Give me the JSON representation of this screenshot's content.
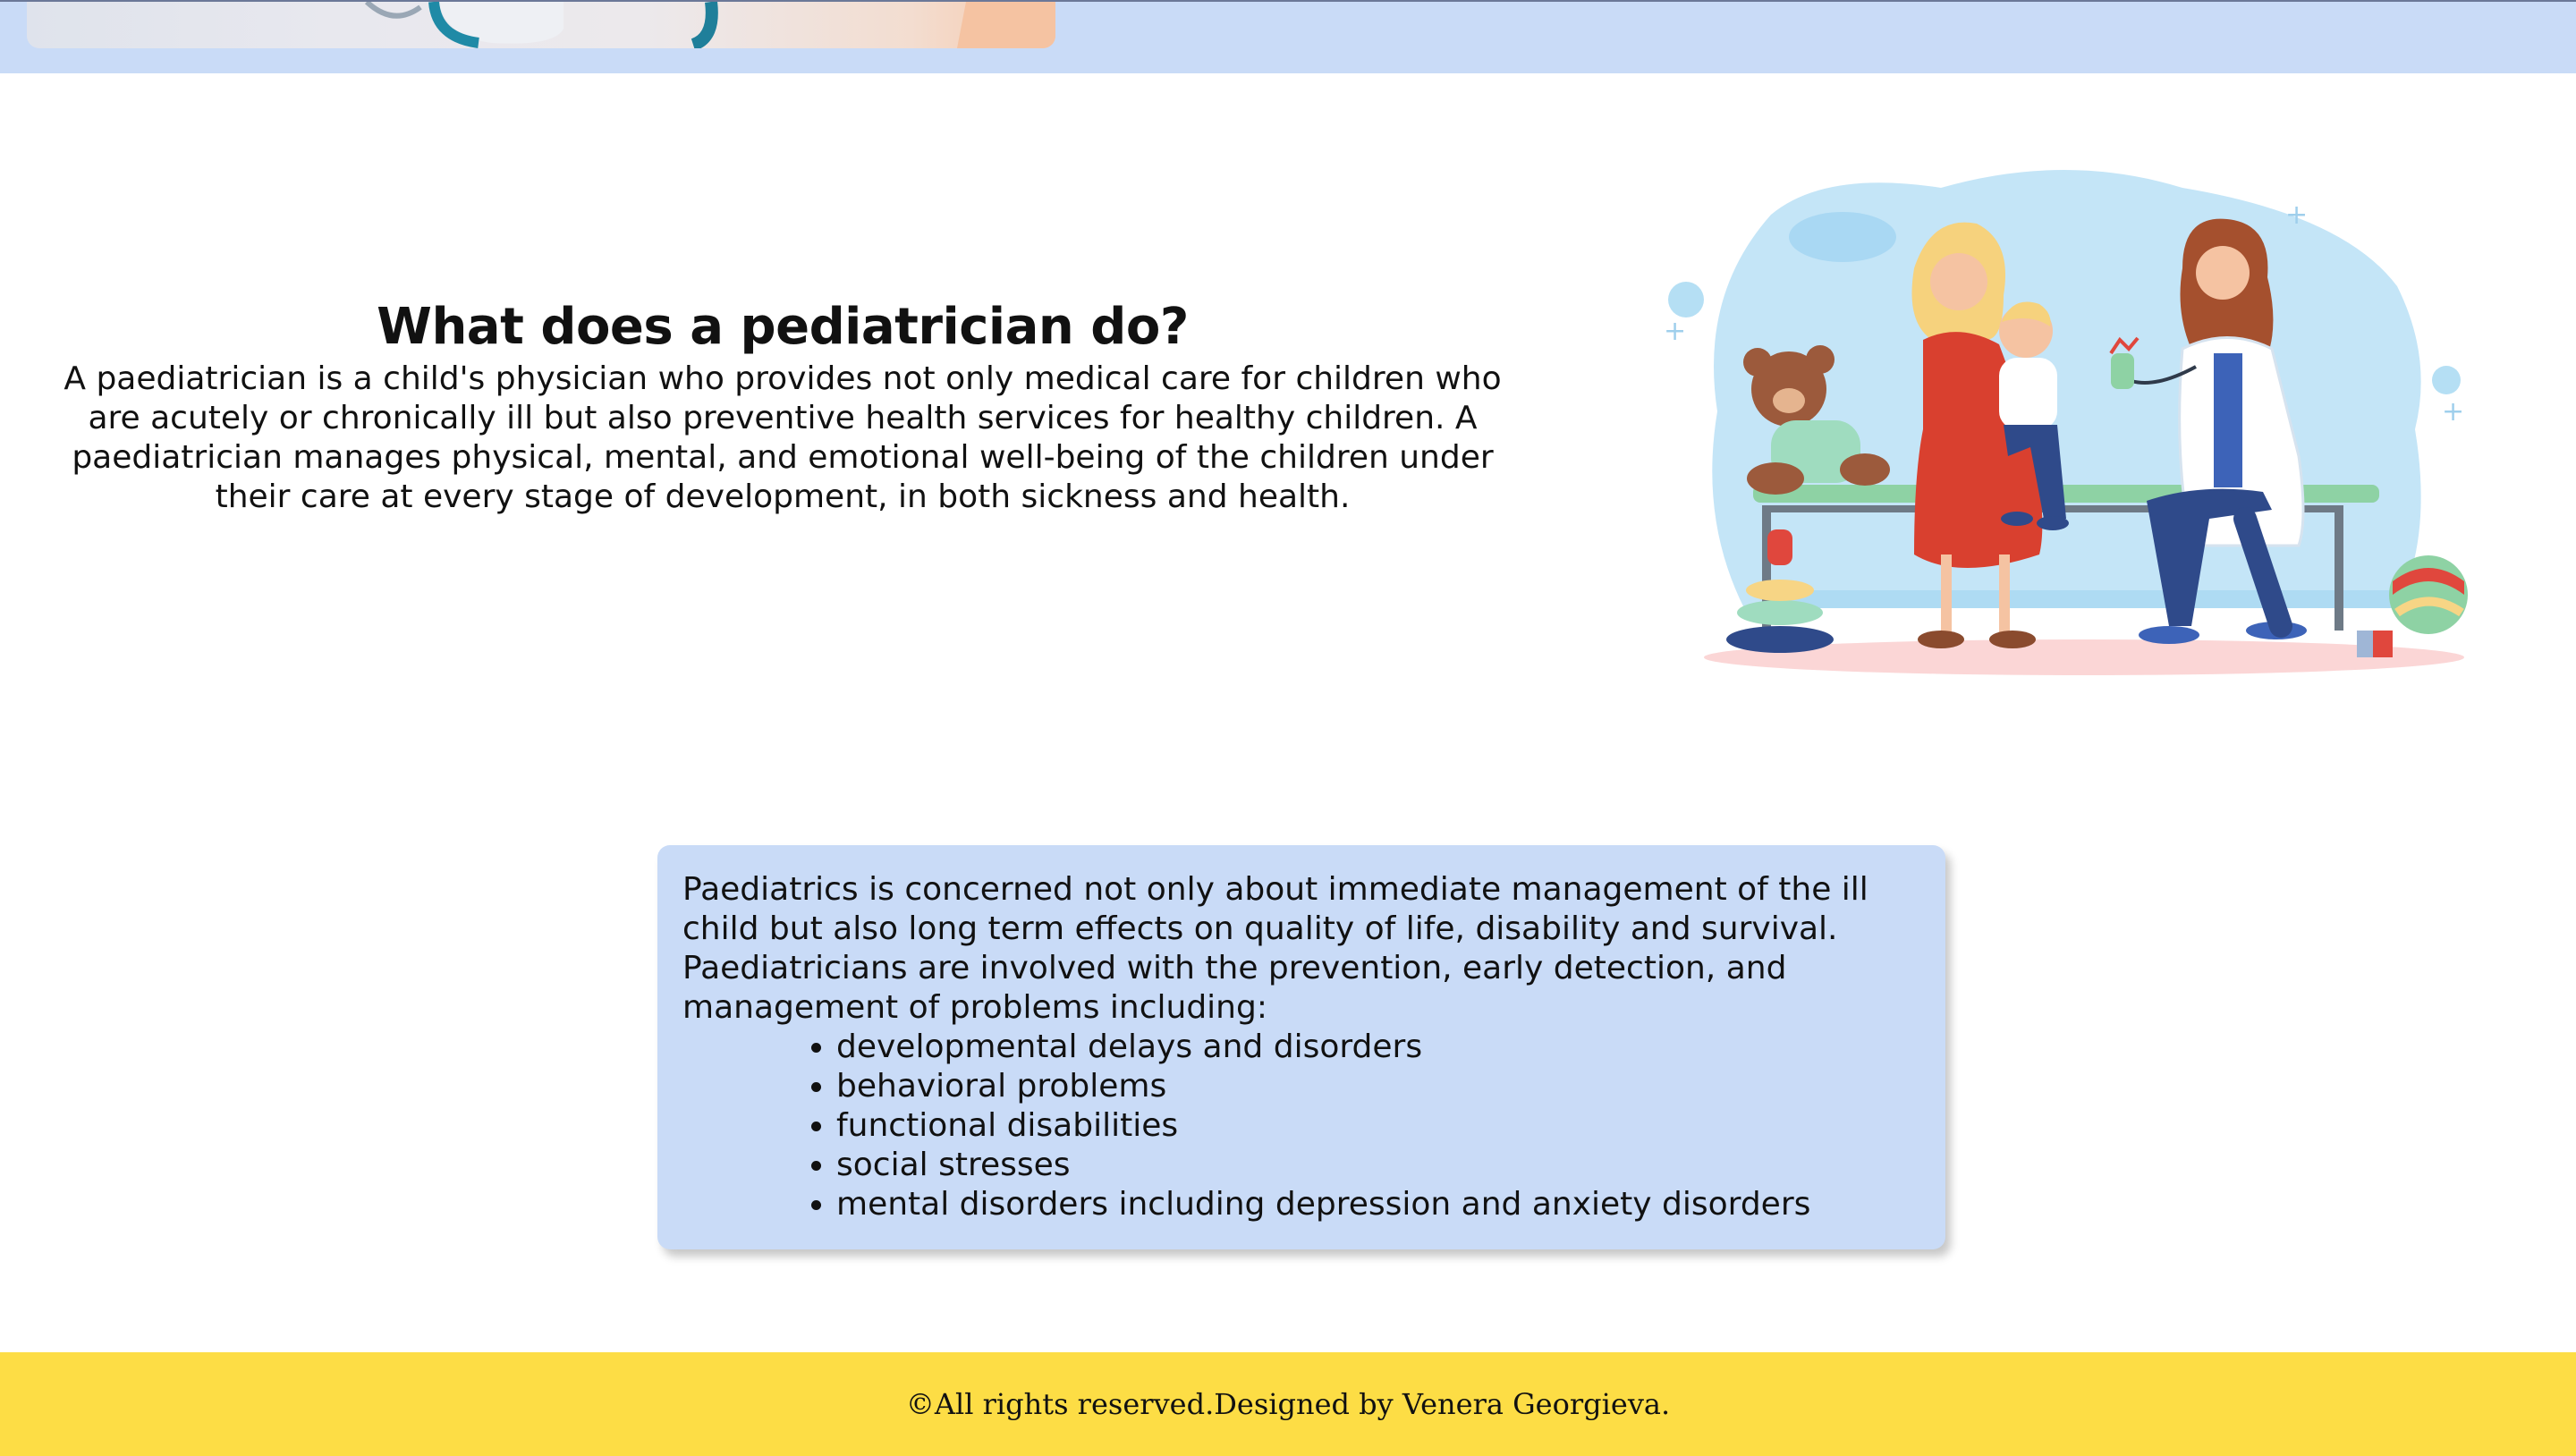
{
  "intro": {
    "heading": "What does a pediatrician do?",
    "text": "A paediatrician is a child's physician who provides not only medical care for children who are acutely or chronically ill but also preventive health services for healthy children. A paediatrician manages physical, mental, and emotional well-being of the children under their care at every stage of development, in both sickness and health."
  },
  "card": {
    "text": "Paediatrics is concerned not only about immediate management of the ill child but also long term effects on quality of life, disability and survival. Paediatricians are involved with the prevention, early detection, and management of problems including:",
    "items": [
      "developmental delays and disorders",
      "behavioral problems",
      "functional disabilities",
      "social stresses",
      "mental disorders including depression and anxiety disorders"
    ]
  },
  "footer": {
    "text": "©All rights reserved.Designed by Venera Georgieva."
  },
  "colors": {
    "band": "#c9dbf7",
    "card": "#c9dbf7",
    "footer": "#fddd45"
  }
}
